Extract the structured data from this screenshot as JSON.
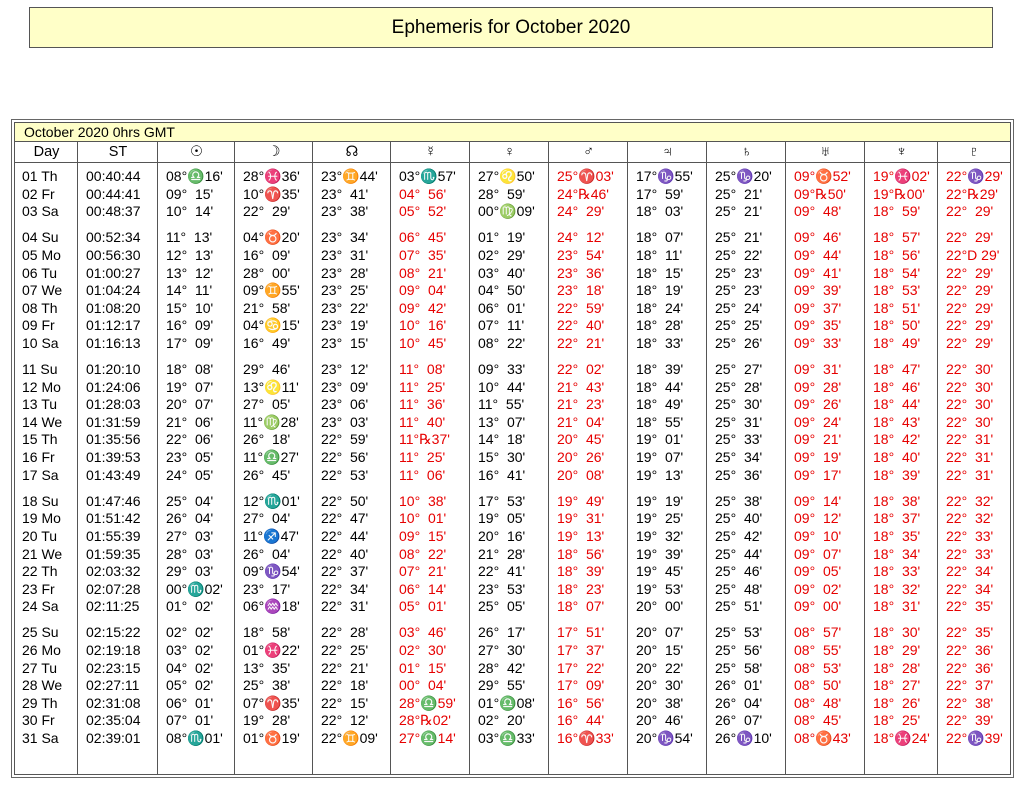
{
  "title": "Ephemeris for October 2020",
  "subtitle": "October 2020  0hrs GMT",
  "colors": {
    "retro": "#e60000",
    "header_bg": "#ffffc8"
  },
  "headers": [
    "Day",
    "ST",
    "☉",
    "☽",
    "☊",
    "☿",
    "♀",
    "♂",
    "♃",
    "♄",
    "♅",
    "♆",
    "♇"
  ],
  "red_columns": [
    7,
    10,
    11,
    12
  ],
  "red_cells": {
    "5": [
      1,
      2,
      3,
      4,
      5,
      6,
      7,
      8,
      9,
      10,
      11,
      12,
      13,
      14,
      15,
      16,
      17,
      18,
      19,
      20,
      21,
      22,
      23,
      24,
      25,
      26,
      27,
      28,
      29,
      30
    ],
    "12": [
      0,
      1,
      2
    ]
  },
  "rows": [
    [
      "01 Th",
      "00:40:44",
      "08°♎16'",
      "28°♓36'",
      "23°♊44'",
      "03°♏57'",
      "27°♌50'",
      "25°♈03'",
      "17°♑55'",
      "25°♑20'",
      "09°♉52'",
      "19°♓02'",
      "22°♑29'"
    ],
    [
      "02 Fr",
      "00:44:41",
      "09°  15'",
      "10°♈35'",
      "23°  41'",
      "04°  56'",
      "28°  59'",
      "24°℞46'",
      "17°  59'",
      "25°  21'",
      "09°℞50'",
      "19°℞00'",
      "22°℞29'"
    ],
    [
      "03 Sa",
      "00:48:37",
      "10°  14'",
      "22°  29'",
      "23°  38'",
      "05°  52'",
      "00°♍09'",
      "24°  29'",
      "18°  03'",
      "25°  21'",
      "09°  48'",
      "18°  59'",
      "22°  29'"
    ],
    [
      "04 Su",
      "00:52:34",
      "11°  13'",
      "04°♉20'",
      "23°  34'",
      "06°  45'",
      "01°  19'",
      "24°  12'",
      "18°  07'",
      "25°  21'",
      "09°  46'",
      "18°  57'",
      "22°  29'"
    ],
    [
      "05 Mo",
      "00:56:30",
      "12°  13'",
      "16°  09'",
      "23°  31'",
      "07°  35'",
      "02°  29'",
      "23°  54'",
      "18°  11'",
      "25°  22'",
      "09°  44'",
      "18°  56'",
      "22°D 29'"
    ],
    [
      "06 Tu",
      "01:00:27",
      "13°  12'",
      "28°  00'",
      "23°  28'",
      "08°  21'",
      "03°  40'",
      "23°  36'",
      "18°  15'",
      "25°  23'",
      "09°  41'",
      "18°  54'",
      "22°  29'"
    ],
    [
      "07 We",
      "01:04:24",
      "14°  11'",
      "09°♊55'",
      "23°  25'",
      "09°  04'",
      "04°  50'",
      "23°  18'",
      "18°  19'",
      "25°  23'",
      "09°  39'",
      "18°  53'",
      "22°  29'"
    ],
    [
      "08 Th",
      "01:08:20",
      "15°  10'",
      "21°  58'",
      "23°  22'",
      "09°  42'",
      "06°  01'",
      "22°  59'",
      "18°  24'",
      "25°  24'",
      "09°  37'",
      "18°  51'",
      "22°  29'"
    ],
    [
      "09 Fr",
      "01:12:17",
      "16°  09'",
      "04°♋15'",
      "23°  19'",
      "10°  16'",
      "07°  11'",
      "22°  40'",
      "18°  28'",
      "25°  25'",
      "09°  35'",
      "18°  50'",
      "22°  29'"
    ],
    [
      "10 Sa",
      "01:16:13",
      "17°  09'",
      "16°  49'",
      "23°  15'",
      "10°  45'",
      "08°  22'",
      "22°  21'",
      "18°  33'",
      "25°  26'",
      "09°  33'",
      "18°  49'",
      "22°  29'"
    ],
    [
      "11 Su",
      "01:20:10",
      "18°  08'",
      "29°  46'",
      "23°  12'",
      "11°  08'",
      "09°  33'",
      "22°  02'",
      "18°  39'",
      "25°  27'",
      "09°  31'",
      "18°  47'",
      "22°  30'"
    ],
    [
      "12 Mo",
      "01:24:06",
      "19°  07'",
      "13°♌11'",
      "23°  09'",
      "11°  25'",
      "10°  44'",
      "21°  43'",
      "18°  44'",
      "25°  28'",
      "09°  28'",
      "18°  46'",
      "22°  30'"
    ],
    [
      "13 Tu",
      "01:28:03",
      "20°  07'",
      "27°  05'",
      "23°  06'",
      "11°  36'",
      "11°  55'",
      "21°  23'",
      "18°  49'",
      "25°  30'",
      "09°  26'",
      "18°  44'",
      "22°  30'"
    ],
    [
      "14 We",
      "01:31:59",
      "21°  06'",
      "11°♍28'",
      "23°  03'",
      "11°  40'",
      "13°  07'",
      "21°  04'",
      "18°  55'",
      "25°  31'",
      "09°  24'",
      "18°  43'",
      "22°  30'"
    ],
    [
      "15 Th",
      "01:35:56",
      "22°  06'",
      "26°  18'",
      "22°  59'",
      "11°℞37'",
      "14°  18'",
      "20°  45'",
      "19°  01'",
      "25°  33'",
      "09°  21'",
      "18°  42'",
      "22°  31'"
    ],
    [
      "16 Fr",
      "01:39:53",
      "23°  05'",
      "11°♎27'",
      "22°  56'",
      "11°  25'",
      "15°  30'",
      "20°  26'",
      "19°  07'",
      "25°  34'",
      "09°  19'",
      "18°  40'",
      "22°  31'"
    ],
    [
      "17 Sa",
      "01:43:49",
      "24°  05'",
      "26°  45'",
      "22°  53'",
      "11°  06'",
      "16°  41'",
      "20°  08'",
      "19°  13'",
      "25°  36'",
      "09°  17'",
      "18°  39'",
      "22°  31'"
    ],
    [
      "18 Su",
      "01:47:46",
      "25°  04'",
      "12°♏01'",
      "22°  50'",
      "10°  38'",
      "17°  53'",
      "19°  49'",
      "19°  19'",
      "25°  38'",
      "09°  14'",
      "18°  38'",
      "22°  32'"
    ],
    [
      "19 Mo",
      "01:51:42",
      "26°  04'",
      "27°  04'",
      "22°  47'",
      "10°  01'",
      "19°  05'",
      "19°  31'",
      "19°  25'",
      "25°  40'",
      "09°  12'",
      "18°  37'",
      "22°  32'"
    ],
    [
      "20 Tu",
      "01:55:39",
      "27°  03'",
      "11°♐47'",
      "22°  44'",
      "09°  15'",
      "20°  16'",
      "19°  13'",
      "19°  32'",
      "25°  42'",
      "09°  10'",
      "18°  35'",
      "22°  33'"
    ],
    [
      "21 We",
      "01:59:35",
      "28°  03'",
      "26°  04'",
      "22°  40'",
      "08°  22'",
      "21°  28'",
      "18°  56'",
      "19°  39'",
      "25°  44'",
      "09°  07'",
      "18°  34'",
      "22°  33'"
    ],
    [
      "22 Th",
      "02:03:32",
      "29°  03'",
      "09°♑54'",
      "22°  37'",
      "07°  21'",
      "22°  41'",
      "18°  39'",
      "19°  45'",
      "25°  46'",
      "09°  05'",
      "18°  33'",
      "22°  34'"
    ],
    [
      "23 Fr",
      "02:07:28",
      "00°♏02'",
      "23°  17'",
      "22°  34'",
      "06°  14'",
      "23°  53'",
      "18°  23'",
      "19°  53'",
      "25°  48'",
      "09°  02'",
      "18°  32'",
      "22°  34'"
    ],
    [
      "24 Sa",
      "02:11:25",
      "01°  02'",
      "06°♒18'",
      "22°  31'",
      "05°  01'",
      "25°  05'",
      "18°  07'",
      "20°  00'",
      "25°  51'",
      "09°  00'",
      "18°  31'",
      "22°  35'"
    ],
    [
      "25 Su",
      "02:15:22",
      "02°  02'",
      "18°  58'",
      "22°  28'",
      "03°  46'",
      "26°  17'",
      "17°  51'",
      "20°  07'",
      "25°  53'",
      "08°  57'",
      "18°  30'",
      "22°  35'"
    ],
    [
      "26 Mo",
      "02:19:18",
      "03°  02'",
      "01°♓22'",
      "22°  25'",
      "02°  30'",
      "27°  30'",
      "17°  37'",
      "20°  15'",
      "25°  56'",
      "08°  55'",
      "18°  29'",
      "22°  36'"
    ],
    [
      "27 Tu",
      "02:23:15",
      "04°  02'",
      "13°  35'",
      "22°  21'",
      "01°  15'",
      "28°  42'",
      "17°  22'",
      "20°  22'",
      "25°  58'",
      "08°  53'",
      "18°  28'",
      "22°  36'"
    ],
    [
      "28 We",
      "02:27:11",
      "05°  02'",
      "25°  38'",
      "22°  18'",
      "00°  04'",
      "29°  55'",
      "17°  09'",
      "20°  30'",
      "26°  01'",
      "08°  50'",
      "18°  27'",
      "22°  37'"
    ],
    [
      "29 Th",
      "02:31:08",
      "06°  01'",
      "07°♈35'",
      "22°  15'",
      "28°♎59'",
      "01°♎08'",
      "16°  56'",
      "20°  38'",
      "26°  04'",
      "08°  48'",
      "18°  26'",
      "22°  38'"
    ],
    [
      "30 Fr",
      "02:35:04",
      "07°  01'",
      "19°  28'",
      "22°  12'",
      "28°℞02'",
      "02°  20'",
      "16°  44'",
      "20°  46'",
      "26°  07'",
      "08°  45'",
      "18°  25'",
      "22°  39'"
    ],
    [
      "31 Sa",
      "02:39:01",
      "08°♏01'",
      "01°♉19'",
      "22°♊09'",
      "27°♎14'",
      "03°♎33'",
      "16°♈33'",
      "20°♑54'",
      "26°♑10'",
      "08°♉43'",
      "18°♓24'",
      "22°♑39'"
    ]
  ]
}
